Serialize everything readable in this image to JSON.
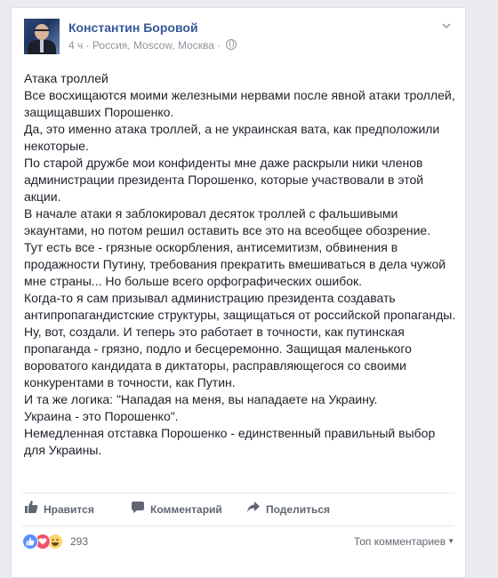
{
  "post": {
    "author": "Константин Боровой",
    "time": "4 ч",
    "location": " · Россия, Moscow, Москва · ",
    "paragraphs": [
      "Атака троллей",
      "Все восхищаются моими железными нервами после явной атаки троллей, защищавших Порошенко.",
      "Да, это именно атака троллей, а не украинская вата, как предположили некоторые.",
      "По старой дружбе мои конфиденты мне даже раскрыли ники членов администрации президента Порошенко, которые участвовали в этой акции.",
      "В начале атаки я заблокировал десяток троллей с фальшивыми экаунтами, но потом решил оставить все это на всеобщее обозрение.",
      "Тут есть все - грязные оскорбления, антисемитизм, обвинения в продажности Путину, требования прекратить вмешиваться в дела чужой мне страны... Но больше всего орфографических ошибок.",
      "Когда-то я сам призывал администрацию президента создавать антипропагандистские структуры, защищаться от российской пропаганды.",
      "Ну, вот, создали. И теперь это работает в точности, как путинская пропаганда - грязно, подло и бесцеремонно. Защищая маленького вороватого кандидата в диктаторы, расправляющегося со своими конкурентами в точности, как Путин.",
      "И та же логика: \"Нападая на меня, вы нападаете на Украину.",
      "Украина - это Порошенко\".",
      "Немедленная отставка Порошенко - единственный правильный выбор для Украины."
    ]
  },
  "actions": {
    "like": "Нравится",
    "comment": "Комментарий",
    "share": "Поделиться"
  },
  "reactions": {
    "count": "293",
    "top_comments": "Топ комментариев"
  },
  "colors": {
    "link": "#365899",
    "like_blue": "#5890ff",
    "love_red": "#f25268",
    "haha_yellow": "#fcd669"
  }
}
